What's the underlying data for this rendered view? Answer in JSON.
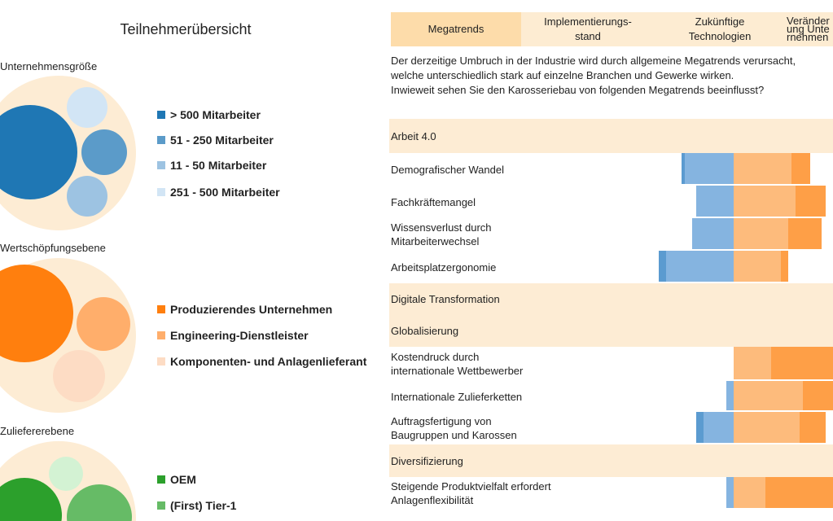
{
  "left": {
    "title": "Teilnehmerübersicht",
    "groups": [
      {
        "label": "Unternehmensgröße",
        "legend": [
          "> 500 Mitarbeiter",
          "51 - 250 Mitarbeiter",
          "11 - 50 Mitarbeiter",
          "251 - 500 Mitarbeiter"
        ],
        "colors": [
          "#1f77b4",
          "#5b9bc9",
          "#9dc3e2",
          "#d2e5f5"
        ]
      },
      {
        "label": "Wertschöpfungsebene",
        "legend": [
          "Produzierendes Unternehmen",
          "Engineering-Dienstleister",
          "Komponenten- und Anlagenlieferant"
        ],
        "colors": [
          "#ff7f0e",
          "#ffae6b",
          "#fddcc4"
        ]
      },
      {
        "label": "Zuliefererebene",
        "legend": [
          "OEM",
          "(First) Tier-1"
        ],
        "colors": [
          "#2ca02c",
          "#66bb66",
          "#d3f2d3"
        ]
      }
    ]
  },
  "tabs": [
    "Megatrends",
    "Implementierungs-stand",
    "Zukünftige Technologien",
    "Veränderung Unternehmen"
  ],
  "intro": [
    "Der derzeitige Umbruch in der Industrie wird durch allgemeine Megatrends verursacht,",
    "welche unterschiedlich stark auf einzelne Branchen und Gewerke wirken.",
    "Inwieweit sehen Sie den Karosseriebau von folgenden Megatrends beeinflusst?"
  ],
  "chart_data": {
    "type": "bar",
    "stacked": "diverging",
    "segments": [
      "strongly negative",
      "negative",
      "positive",
      "strongly positive"
    ],
    "colors": {
      "neg2": "#5b9bd0",
      "neg1": "#85b4e0",
      "pos1": "#fdbb7c",
      "pos2": "#fe9f47",
      "band": "#fdecd4"
    },
    "rows": [
      {
        "section": "Arbeit 4.0"
      },
      {
        "label": [
          "Demografischer Wandel"
        ],
        "values": [
          2,
          26,
          31,
          10
        ]
      },
      {
        "label": [
          "Fachkräftemangel"
        ],
        "values": [
          0,
          20,
          33,
          16
        ]
      },
      {
        "label": [
          "Wissensverlust durch",
          "Mitarbeiterwechsel"
        ],
        "values": [
          0,
          22,
          29,
          18
        ]
      },
      {
        "label": [
          "Arbeitsplatzergonomie"
        ],
        "values": [
          4,
          36,
          25,
          4
        ]
      },
      {
        "section": "Digitale Transformation"
      },
      {
        "section": "Globalisierung"
      },
      {
        "label": [
          "Kostendruck durch",
          "internationale Wettbewerber"
        ],
        "values": [
          0,
          0,
          20,
          35
        ]
      },
      {
        "label": [
          "Internationale Zulieferketten"
        ],
        "values": [
          0,
          4,
          37,
          22
        ]
      },
      {
        "label": [
          "Auftragsfertigung von",
          "Baugruppen und Karossen"
        ],
        "values": [
          4,
          16,
          35,
          14
        ]
      },
      {
        "section": "Diversifizierung"
      },
      {
        "label": [
          "Steigende Produktvielfalt erfordert",
          "Anlagenflexibilität"
        ],
        "values": [
          0,
          4,
          17,
          40
        ]
      }
    ]
  }
}
